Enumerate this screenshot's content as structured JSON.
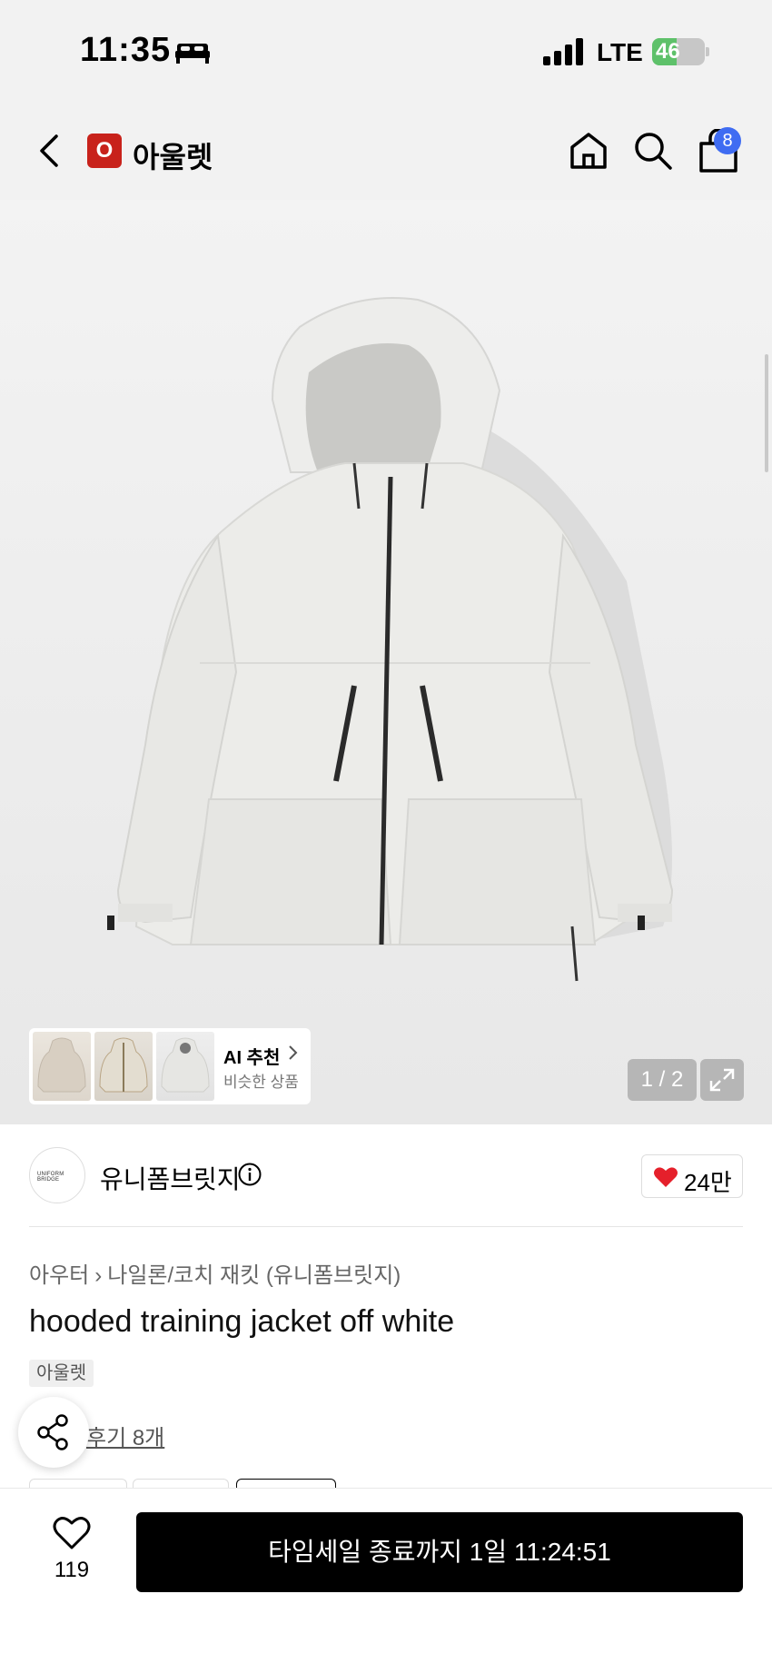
{
  "status_bar": {
    "time": "11:35",
    "network": "LTE",
    "battery": "46",
    "battery_level": 0.46
  },
  "nav": {
    "logo_letter": "O",
    "title": "아울렛",
    "cart_count": "8",
    "icons": [
      "back-icon",
      "home-icon",
      "search-icon",
      "cart-icon"
    ]
  },
  "gallery": {
    "page_counter": "1 / 2",
    "ai_title": "AI 추천",
    "ai_subtitle": "비슷한 상품"
  },
  "brand": {
    "avatar_text": "UNIFORM BRIDGE",
    "name": "유니폼브릿지",
    "likes": "24만"
  },
  "product": {
    "breadcrumb": [
      "아우터",
      "나일론/코치 재킷 (유니폼브릿지)"
    ],
    "title": "hooded training jacket off white",
    "tag": "아울렛",
    "reviews_link": "후기 8개"
  },
  "bottom_bar": {
    "wish_count": "119",
    "timesale_label": "타임세일 종료까지 1일 11:24:51"
  },
  "colors": {
    "brand_red": "#c8221b",
    "badge_blue": "#3f6cf2",
    "heart_red": "#e5202b",
    "battery_green": "#5ec16a"
  }
}
